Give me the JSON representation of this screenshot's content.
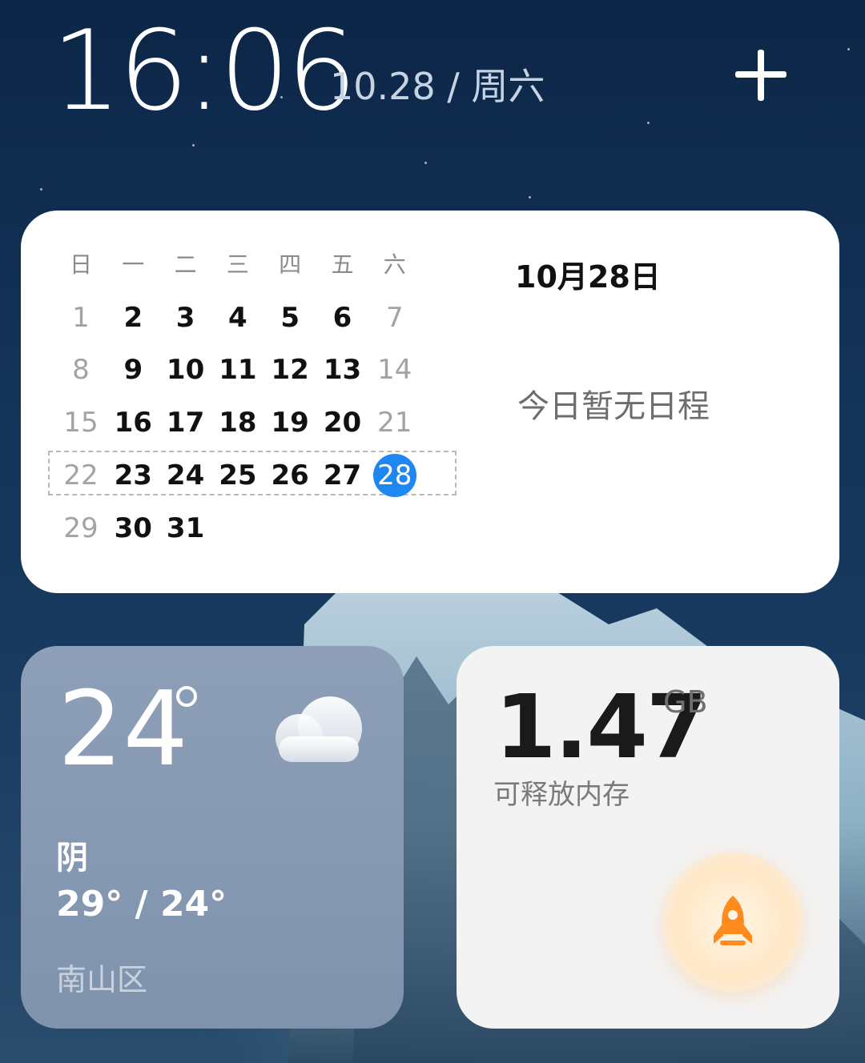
{
  "clock": {
    "time": "16:06",
    "date": "10.28 / 周六"
  },
  "calendar": {
    "weekdays": [
      "日",
      "一",
      "二",
      "三",
      "四",
      "五",
      "六"
    ],
    "weeks": [
      [
        "1",
        "2",
        "3",
        "4",
        "5",
        "6",
        "7"
      ],
      [
        "8",
        "9",
        "10",
        "11",
        "12",
        "13",
        "14"
      ],
      [
        "15",
        "16",
        "17",
        "18",
        "19",
        "20",
        "21"
      ],
      [
        "22",
        "23",
        "24",
        "25",
        "26",
        "27",
        "28"
      ],
      [
        "29",
        "30",
        "31",
        "",
        "",
        "",
        ""
      ]
    ],
    "today": "28",
    "selected_date": "10月28日",
    "empty_message": "今日暂无日程",
    "accent_color": "#1e88f0"
  },
  "weather": {
    "temperature": "24",
    "condition": "阴",
    "range": "29° / 24°",
    "location": "南山区",
    "icon": "cloud-icon"
  },
  "memory": {
    "value": "1.47",
    "unit": "GB",
    "label": "可释放内存",
    "icon": "rocket-icon",
    "accent_color": "#ff8a1e"
  },
  "toolbar": {
    "add_icon": "plus-icon"
  }
}
